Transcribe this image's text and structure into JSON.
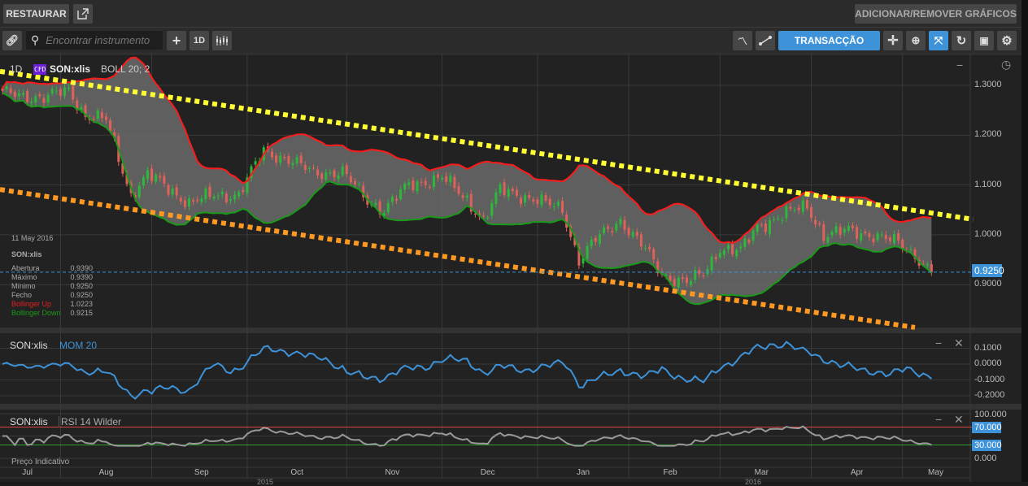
{
  "topbar": {
    "restore_label": "RESTAURAR",
    "add_remove_label": "ADICIONAR/REMOVER GRÁFICOS"
  },
  "toolbar": {
    "search_placeholder": "Encontrar instrumento",
    "interval_label": "1D",
    "trade_label": "TRANSACÇÃO"
  },
  "main": {
    "interval": "1D",
    "badge": "CFD",
    "symbol": "SON:xlis",
    "indicator": "BOLL 20; 2",
    "last_price": "0.9250",
    "y_ticks": [
      "1.3000",
      "1.2000",
      "1.1000",
      "1.0000",
      "0.9000"
    ],
    "legend": {
      "date": "11 May 2016",
      "symbol": "SON:xlis",
      "rows": [
        {
          "label": "Abertura",
          "value": "0.9390"
        },
        {
          "label": "Máximo",
          "value": "0.9390"
        },
        {
          "label": "Mínimo",
          "value": "0.9250"
        },
        {
          "label": "Fecho",
          "value": "0.9250"
        },
        {
          "label": "Bollinger Up",
          "value": "1.0223"
        },
        {
          "label": "Bollinger Down",
          "value": "0.9215"
        }
      ]
    }
  },
  "mom": {
    "symbol": "SON:xlis",
    "indicator": "MOM 20",
    "y_ticks": [
      "0.1000",
      "0.0000",
      "-0.1000",
      "-0.2000"
    ]
  },
  "rsi": {
    "symbol": "SON:xlis",
    "indicator": "RSI 14 Wilder",
    "y_ticks": [
      "100.000",
      "0.000"
    ],
    "upper": "70.000",
    "lower": "30.000"
  },
  "footer": {
    "note": "Preço Indicativo",
    "years": [
      "2015",
      "2016"
    ]
  },
  "colors": {
    "up": "#2db83d",
    "down": "#e0605a",
    "boll_up": "#ff1a1a",
    "boll_down": "#1a9a1a",
    "accent": "#3d92d8",
    "trend_upper": "#ffff33",
    "trend_lower": "#ff9922"
  },
  "chart_data": {
    "type": "candlestick",
    "bars": 225,
    "price_anchors": [
      [
        0,
        1.284
      ],
      [
        10,
        1.275
      ],
      [
        16,
        1.29
      ],
      [
        20,
        1.24
      ],
      [
        25,
        1.23
      ],
      [
        29,
        1.13
      ],
      [
        31,
        1.08
      ],
      [
        35,
        1.12
      ],
      [
        39,
        1.1
      ],
      [
        45,
        1.063
      ],
      [
        51,
        1.08
      ],
      [
        57,
        1.08
      ],
      [
        63,
        1.17
      ],
      [
        69,
        1.15
      ],
      [
        75,
        1.125
      ],
      [
        82,
        1.125
      ],
      [
        88,
        1.07
      ],
      [
        92,
        1.05
      ],
      [
        98,
        1.1
      ],
      [
        106,
        1.115
      ],
      [
        112,
        1.07
      ],
      [
        116,
        1.03
      ],
      [
        120,
        1.09
      ],
      [
        127,
        1.075
      ],
      [
        135,
        1.05
      ],
      [
        139,
        0.95
      ],
      [
        143,
        0.99
      ],
      [
        149,
        1.03
      ],
      [
        155,
        0.97
      ],
      [
        159,
        0.92
      ],
      [
        165,
        0.905
      ],
      [
        169,
        0.92
      ],
      [
        173,
        0.975
      ],
      [
        178,
        0.967
      ],
      [
        182,
        1.016
      ],
      [
        188,
        1.04
      ],
      [
        194,
        1.057
      ],
      [
        198,
        1.0
      ],
      [
        204,
        1.008
      ],
      [
        210,
        1.0
      ],
      [
        216,
        0.983
      ],
      [
        220,
        0.96
      ],
      [
        224,
        0.925
      ]
    ],
    "months": [
      {
        "label": "Jul",
        "bar": 6
      },
      {
        "label": "Aug",
        "bar": 25
      },
      {
        "label": "Sep",
        "bar": 48
      },
      {
        "label": "Oct",
        "bar": 71
      },
      {
        "label": "Nov",
        "bar": 94
      },
      {
        "label": "Dec",
        "bar": 117
      },
      {
        "label": "Jan",
        "bar": 140
      },
      {
        "label": "Feb",
        "bar": 161
      },
      {
        "label": "Mar",
        "bar": 183
      },
      {
        "label": "Apr",
        "bar": 206
      },
      {
        "label": "May",
        "bar": 225
      }
    ],
    "month_boundaries": [
      14,
      36,
      59,
      83,
      106,
      129,
      151,
      173,
      195,
      217
    ],
    "trendlines": [
      {
        "name": "upper",
        "from": [
          0,
          1.328
        ],
        "to": [
          234,
          1.031
        ]
      },
      {
        "name": "lower",
        "from": [
          0,
          1.091
        ],
        "to": [
          220,
          0.814
        ]
      }
    ],
    "bollinger": {
      "period": 20,
      "mult": 2
    },
    "momentum": {
      "period": 20
    },
    "rsi": {
      "period": 14,
      "levels": [
        70,
        30
      ]
    }
  }
}
